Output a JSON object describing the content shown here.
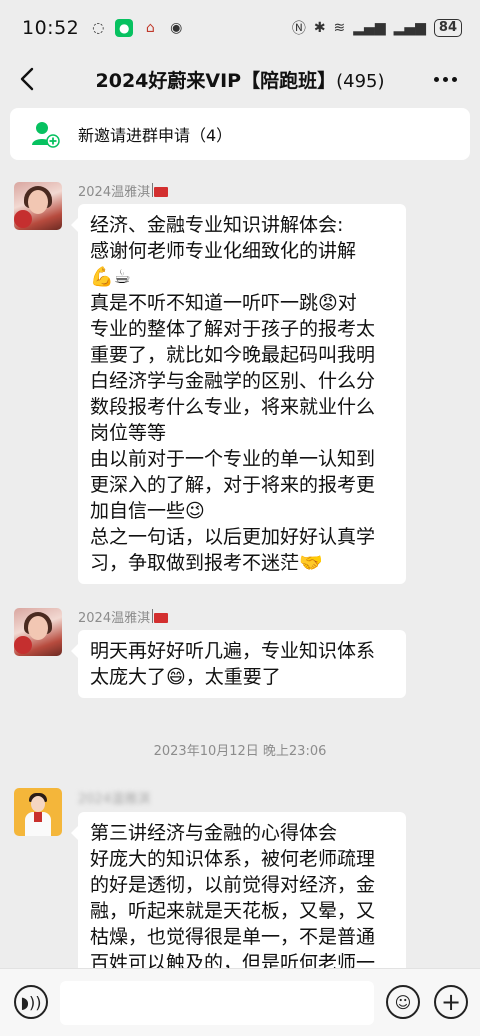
{
  "status_bar": {
    "time": "10:52",
    "battery": "84",
    "left_icons": [
      "chat-bubble-icon",
      "wechat-icon",
      "home-icon",
      "eye-icon"
    ],
    "right_icons": [
      "nfc-icon",
      "bluetooth-icon",
      "wifi-icon",
      "signal-icon",
      "signal-icon"
    ]
  },
  "nav": {
    "title": "2024好蔚来VIP【陪跑班】",
    "count": "(495)"
  },
  "invite": {
    "text": "新邀请进群申请（4）"
  },
  "messages": [
    {
      "sender": "2024温雅淇",
      "lines": [
        "经济、金融专业知识讲解体会:",
        "感谢何老师专业化细致化的讲解",
        "💪☕",
        "真是不听不知道一听吓一跳😡对",
        "专业的整体了解对于孩子的报考太",
        "重要了，就比如今晚最起码叫我明",
        "白经济学与金融学的区别、什么分",
        "数段报考什么专业，将来就业什么",
        "岗位等等",
        "由以前对于一个专业的单一认知到",
        "更深入的了解，对于将来的报考更",
        "加自信一些😉",
        "总之一句话，以后更加好好认真学",
        "习，争取做到报考不迷茫🤝"
      ]
    },
    {
      "sender": "2024温雅淇",
      "lines": [
        "明天再好好听几遍，专业知识体系",
        "太庞大了😄，太重要了"
      ]
    },
    {
      "sender": "2024温雅淇",
      "lines": [
        "第三讲经济与金融的心得体会",
        "好庞大的知识体系，被何老师疏理",
        "的好是透彻，以前觉得对经济，金",
        "融，听起来就是天花板，又晕，又",
        "枯燥，也觉得很是单一，不是普通",
        "百姓可以触及的，但是听何老师一"
      ]
    }
  ],
  "timestamp": "2023年10月12日 晚上23:06",
  "input_bar": {
    "voice_icon": "voice-icon",
    "emoji_icon": "emoji-icon",
    "plus_icon": "plus-icon"
  }
}
